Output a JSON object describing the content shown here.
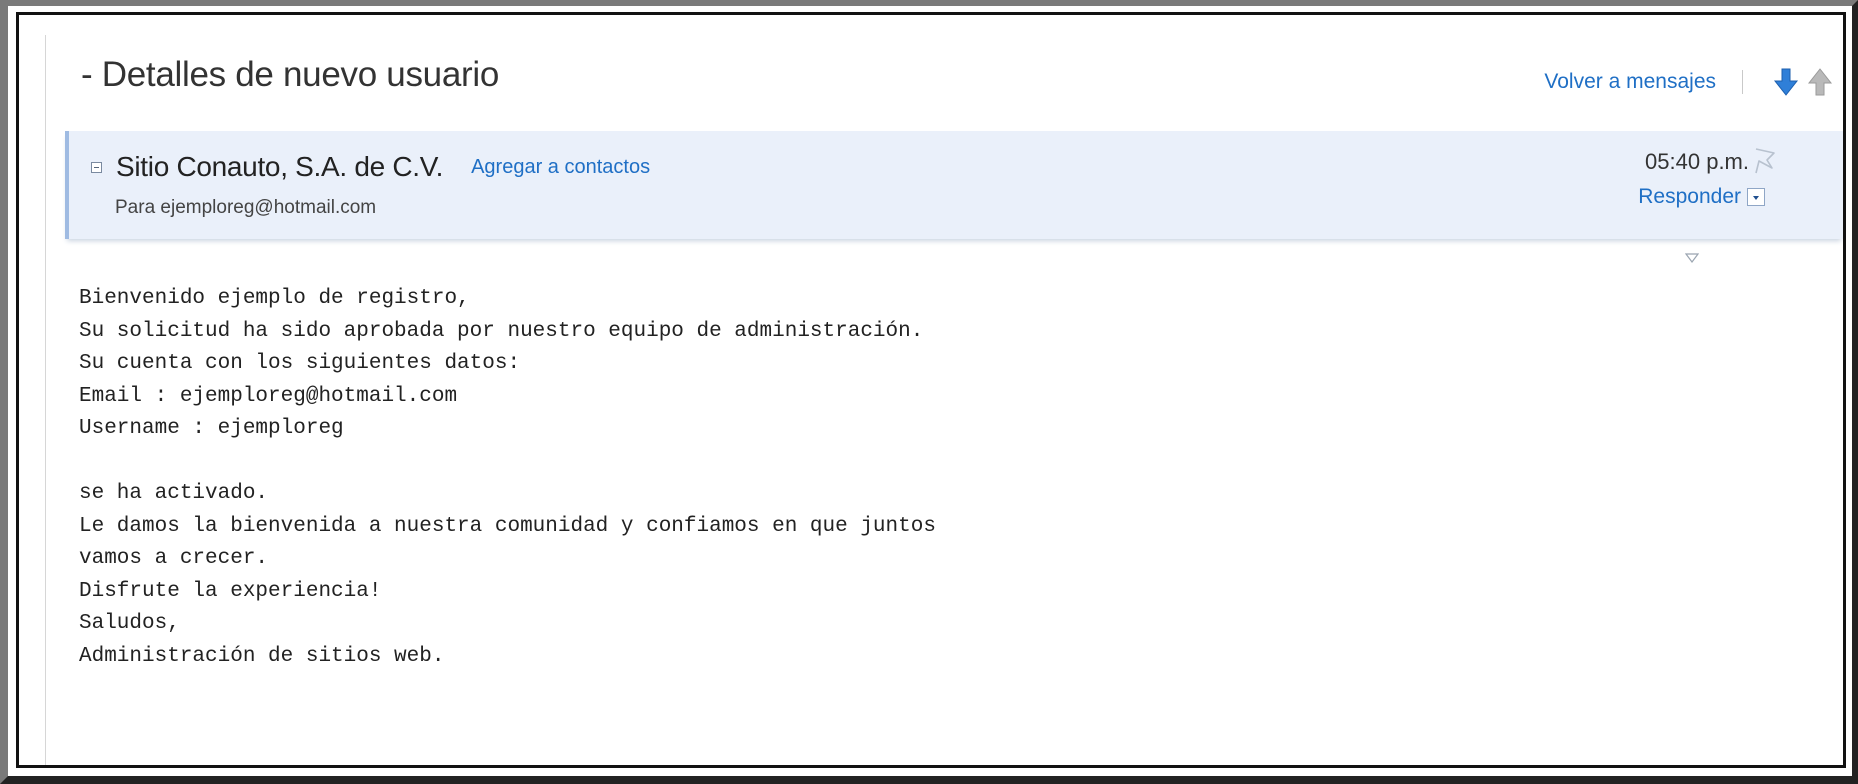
{
  "page": {
    "title": "- Detalles de nuevo usuario",
    "back_link": "Volver a mensajes",
    "icons": {
      "next": "arrow-down-icon",
      "previous": "arrow-up-icon"
    }
  },
  "message": {
    "sender": "Sitio Conauto, S.A. de C.V.",
    "add_contact": "Agregar a contactos",
    "to": "Para ejemploreg@hotmail.com",
    "time": "05:40 p.m.",
    "reply": "Responder",
    "body_lines": [
      "Bienvenido ejemplo de registro,",
      "Su solicitud ha sido aprobada por nuestro equipo de administración.",
      "Su cuenta con los siguientes datos:",
      "Email : ejemploreg@hotmail.com",
      "Username : ejemploreg",
      "",
      "se ha activado.",
      "Le damos la bienvenida a nuestra comunidad y confiamos en que juntos",
      "vamos a crecer.",
      "Disfrute la experiencia!",
      "Saludos,",
      "Administración de sitios web."
    ]
  },
  "colors": {
    "link": "#1f6fc5",
    "header_background": "#eaf0fa",
    "header_accent": "#9fbbe2",
    "arrow_down": "#2f7fd8",
    "arrow_up": "#b9b9b9"
  }
}
